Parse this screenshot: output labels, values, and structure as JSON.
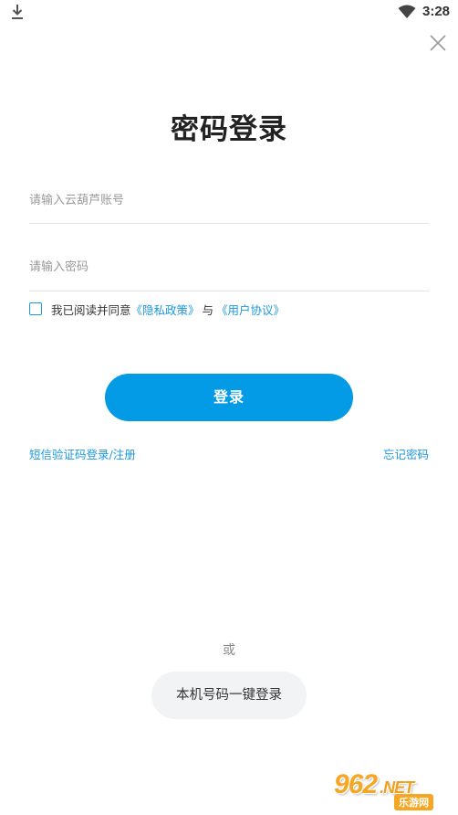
{
  "status_bar": {
    "time": "3:28",
    "left_icon": "download-icon",
    "right_icon": "wifi-icon"
  },
  "header": {
    "close_icon": "close-icon",
    "title": "密码登录"
  },
  "form": {
    "account_placeholder": "请输入云葫芦账号",
    "account_value": "",
    "password_placeholder": "请输入密码",
    "password_value": ""
  },
  "agreement": {
    "checked": false,
    "text": "我已阅读并同意",
    "privacy_link": "《隐私政策》",
    "joiner": "与",
    "user_agreement_link": "《用户协议》"
  },
  "actions": {
    "login_label": "登录",
    "sms_login_label": "短信验证码登录/注册",
    "forgot_password_label": "忘记密码",
    "or_label": "或",
    "one_key_login_label": "本机号码一键登录"
  },
  "watermark": {
    "brand": "962",
    "suffix": ".NET",
    "badge": "乐游网"
  },
  "colors": {
    "accent": "#039be5",
    "link": "#1c98df",
    "secondary_button_bg": "#f2f3f5",
    "watermark": "#f5a623"
  }
}
